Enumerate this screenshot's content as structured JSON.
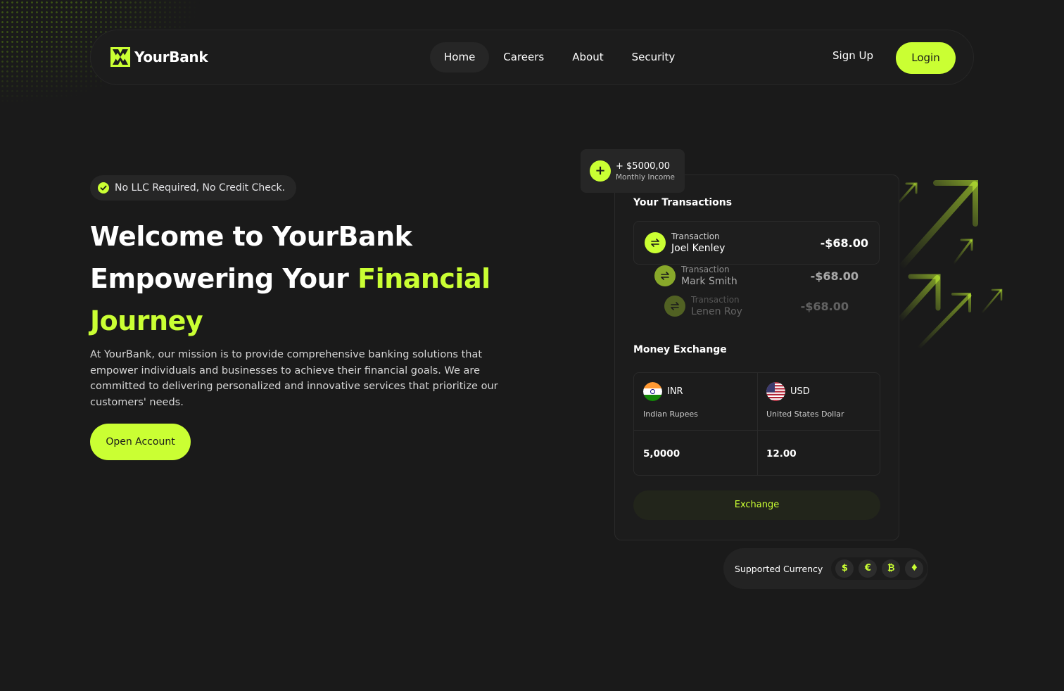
{
  "brand": {
    "name": "YourBank",
    "accent": "#caff33",
    "background": "#1a1a1a"
  },
  "nav": {
    "links": [
      {
        "label": "Home",
        "active": true
      },
      {
        "label": "Careers",
        "active": false
      },
      {
        "label": "About",
        "active": false
      },
      {
        "label": "Security",
        "active": false
      }
    ],
    "signup_label": "Sign Up",
    "login_label": "Login"
  },
  "hero": {
    "badge": "No LLC Required, No Credit Check.",
    "title_line1": "Welcome to YourBank",
    "title_line2_plain": "Empowering Your ",
    "title_line2_accent": "Financial",
    "title_line3_accent": "Journey",
    "description": "At YourBank, our mission is to provide comprehensive banking solutions that empower individuals and businesses to achieve their financial goals. We are committed to delivering personalized and innovative services that prioritize our customers' needs.",
    "cta_label": "Open Account"
  },
  "income_card": {
    "amount": "+ $5000,00",
    "label": "Monthly Income"
  },
  "transactions": {
    "title": "Your Transactions",
    "items": [
      {
        "label": "Transaction",
        "name": "Joel Kenley",
        "amount": "-$68.00"
      },
      {
        "label": "Transaction",
        "name": "Mark Smith",
        "amount": "-$68.00"
      },
      {
        "label": "Transaction",
        "name": "Lenen Roy",
        "amount": "-$68.00"
      }
    ]
  },
  "exchange": {
    "title": "Money Exchange",
    "from": {
      "code": "INR",
      "name": "Indian Rupees",
      "value": "5,0000"
    },
    "to": {
      "code": "USD",
      "name": "United States Dollar",
      "value": "12.00"
    },
    "button_label": "Exchange"
  },
  "supported": {
    "label": "Supported Currency",
    "icons": [
      {
        "symbol": "$",
        "icon": "dollar-icon"
      },
      {
        "symbol": "€",
        "icon": "euro-icon"
      },
      {
        "symbol": "₿",
        "icon": "bitcoin-icon"
      },
      {
        "symbol": "♦",
        "icon": "ethereum-icon"
      }
    ]
  }
}
